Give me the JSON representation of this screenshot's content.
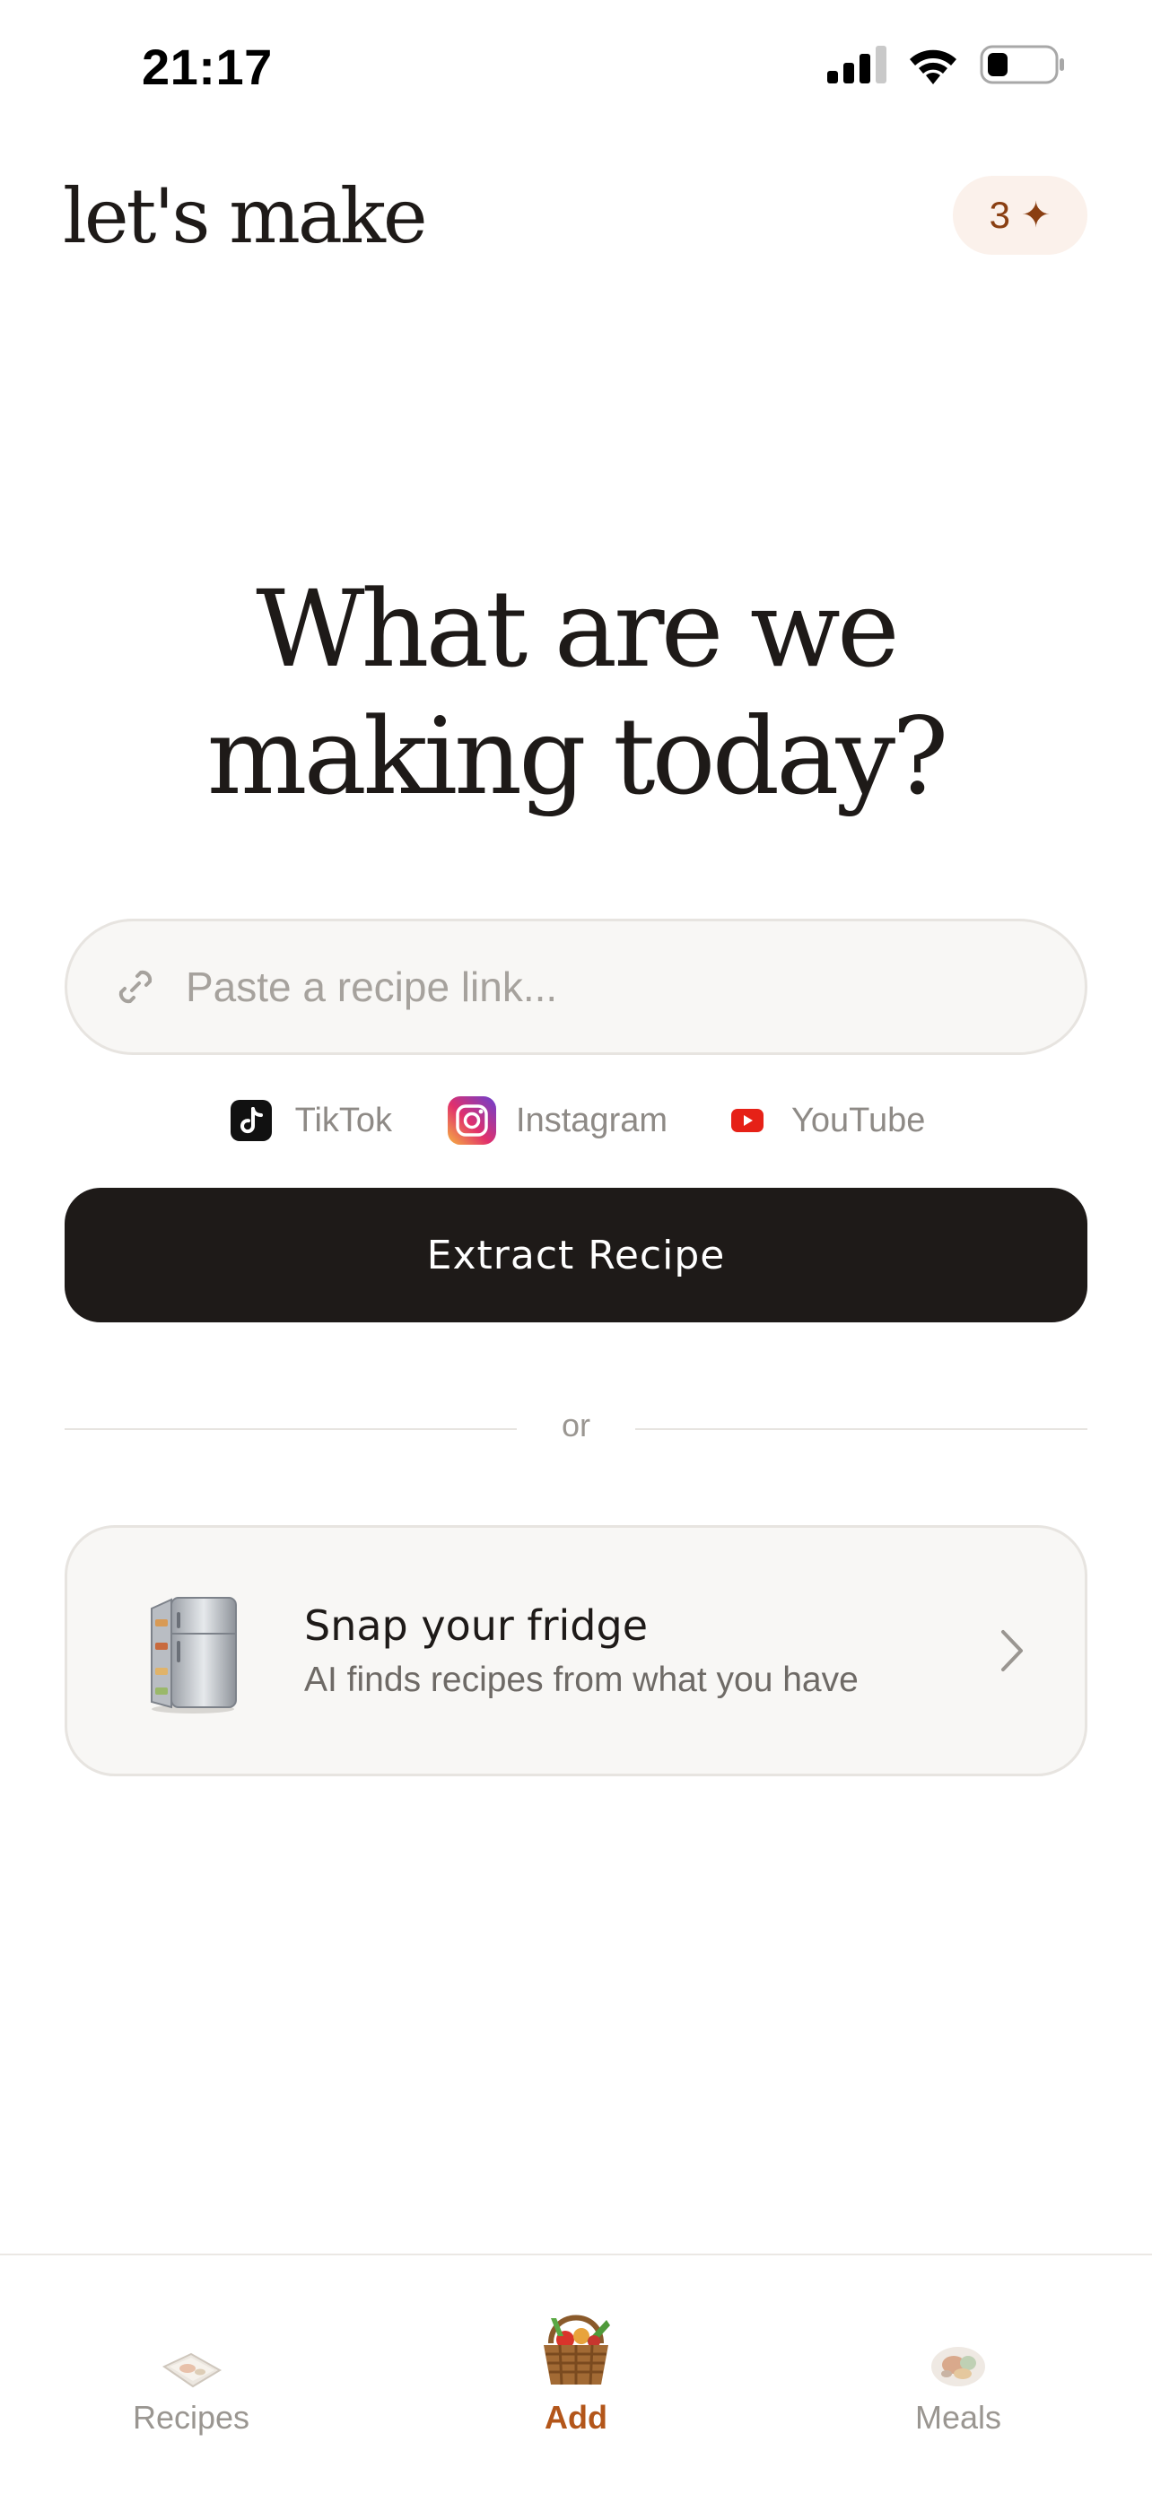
{
  "status_bar": {
    "time": "21:17",
    "icons": [
      "signal-icon",
      "wifi-icon",
      "battery-icon"
    ]
  },
  "header": {
    "title": "let's make",
    "credits": {
      "count": "3",
      "icon": "sparkle-icon",
      "glyph": "✦"
    }
  },
  "hero": {
    "line1": "What are we",
    "line2": "making today?"
  },
  "link_input": {
    "placeholder": "Paste a recipe link...",
    "value": "",
    "icon": "link-icon"
  },
  "sources": [
    {
      "label": "TikTok",
      "icon": "tiktok-icon"
    },
    {
      "label": "Instagram",
      "icon": "instagram-icon"
    },
    {
      "label": "YouTube",
      "icon": "youtube-icon"
    }
  ],
  "extract_button": {
    "label": "Extract Recipe"
  },
  "divider": {
    "label": "or"
  },
  "fridge_card": {
    "title": "Snap your fridge",
    "subtitle": "AI finds recipes from what you have",
    "icon": "fridge-icon"
  },
  "tabbar": {
    "active": "Add",
    "tabs": [
      {
        "label": "Recipes",
        "icon": "recipe-book-icon"
      },
      {
        "label": "Add",
        "icon": "basket-icon"
      },
      {
        "label": "Meals",
        "icon": "meal-icon"
      }
    ]
  },
  "colors": {
    "text": "#1e1a18",
    "accent": "#b3561a",
    "badge_background": "#fbf1eb",
    "button": "#1e1a18",
    "muted": "#9a9691"
  }
}
